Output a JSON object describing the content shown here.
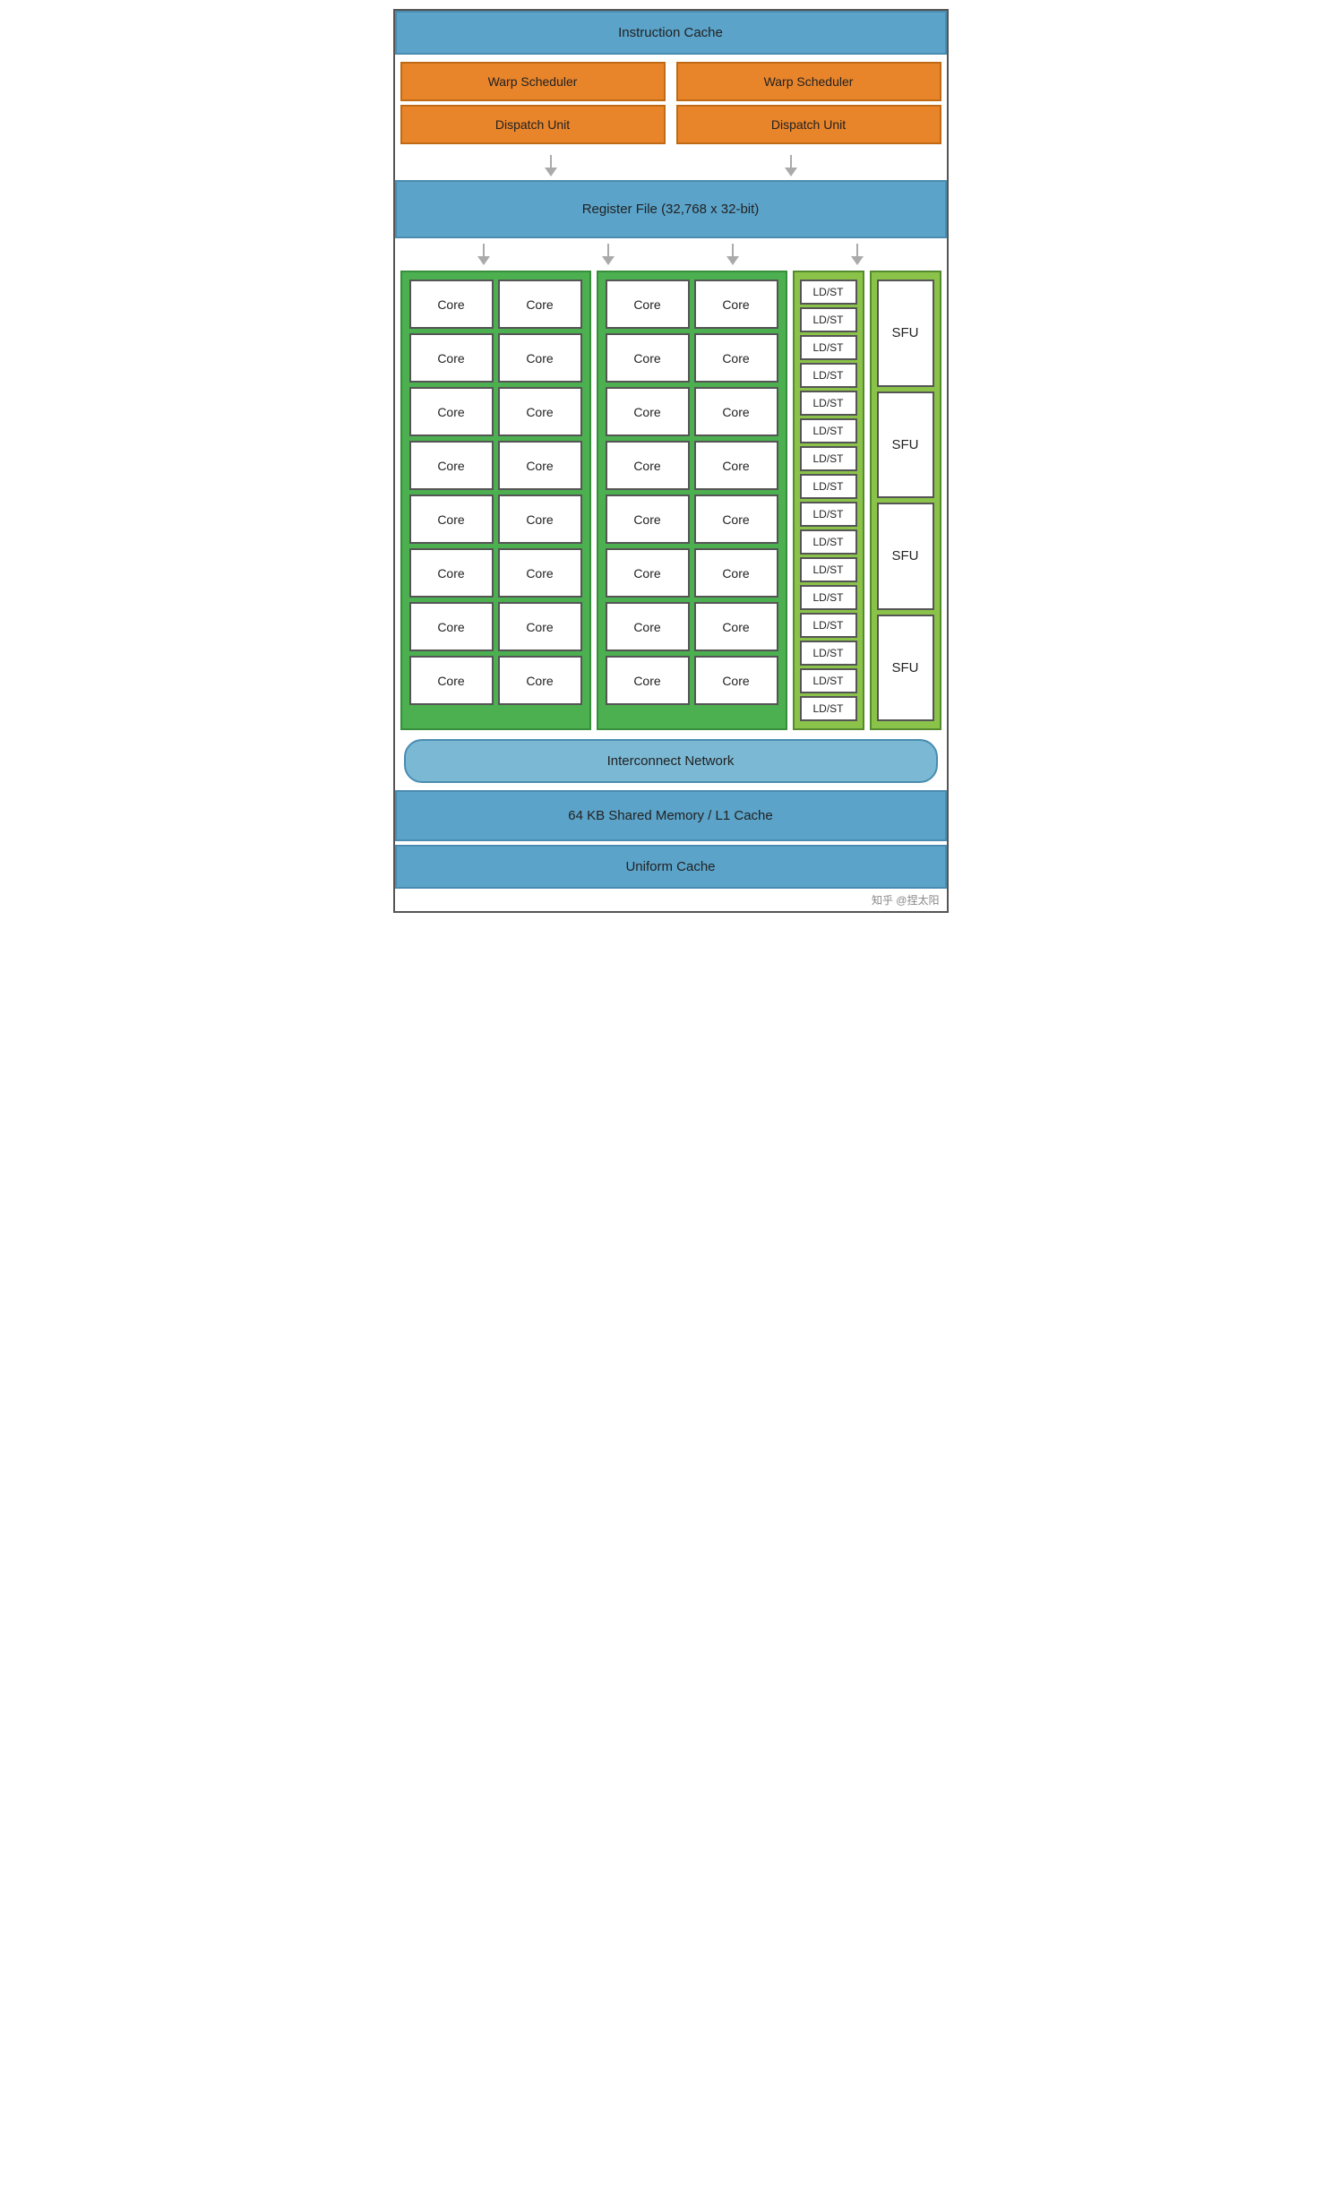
{
  "header": {
    "instr_cache": "Instruction Cache"
  },
  "warp_schedulers": {
    "left": "Warp Scheduler",
    "right": "Warp Scheduler"
  },
  "dispatch_units": {
    "left": "Dispatch Unit",
    "right": "Dispatch Unit"
  },
  "register_file": "Register File (32,768 x 32-bit)",
  "cores": {
    "group1": [
      [
        "Core",
        "Core"
      ],
      [
        "Core",
        "Core"
      ],
      [
        "Core",
        "Core"
      ],
      [
        "Core",
        "Core"
      ],
      [
        "Core",
        "Core"
      ],
      [
        "Core",
        "Core"
      ],
      [
        "Core",
        "Core"
      ],
      [
        "Core",
        "Core"
      ]
    ],
    "group2": [
      [
        "Core",
        "Core"
      ],
      [
        "Core",
        "Core"
      ],
      [
        "Core",
        "Core"
      ],
      [
        "Core",
        "Core"
      ],
      [
        "Core",
        "Core"
      ],
      [
        "Core",
        "Core"
      ],
      [
        "Core",
        "Core"
      ],
      [
        "Core",
        "Core"
      ]
    ]
  },
  "ldst_units": [
    "LD/ST",
    "LD/ST",
    "LD/ST",
    "LD/ST",
    "LD/ST",
    "LD/ST",
    "LD/ST",
    "LD/ST",
    "LD/ST",
    "LD/ST",
    "LD/ST",
    "LD/ST",
    "LD/ST",
    "LD/ST",
    "LD/ST",
    "LD/ST"
  ],
  "sfu_units": [
    "SFU",
    "SFU",
    "SFU",
    "SFU"
  ],
  "interconnect": "Interconnect Network",
  "shared_mem": "64 KB Shared Memory / L1 Cache",
  "uniform_cache": "Uniform Cache",
  "watermark": "知乎 @捏太阳"
}
